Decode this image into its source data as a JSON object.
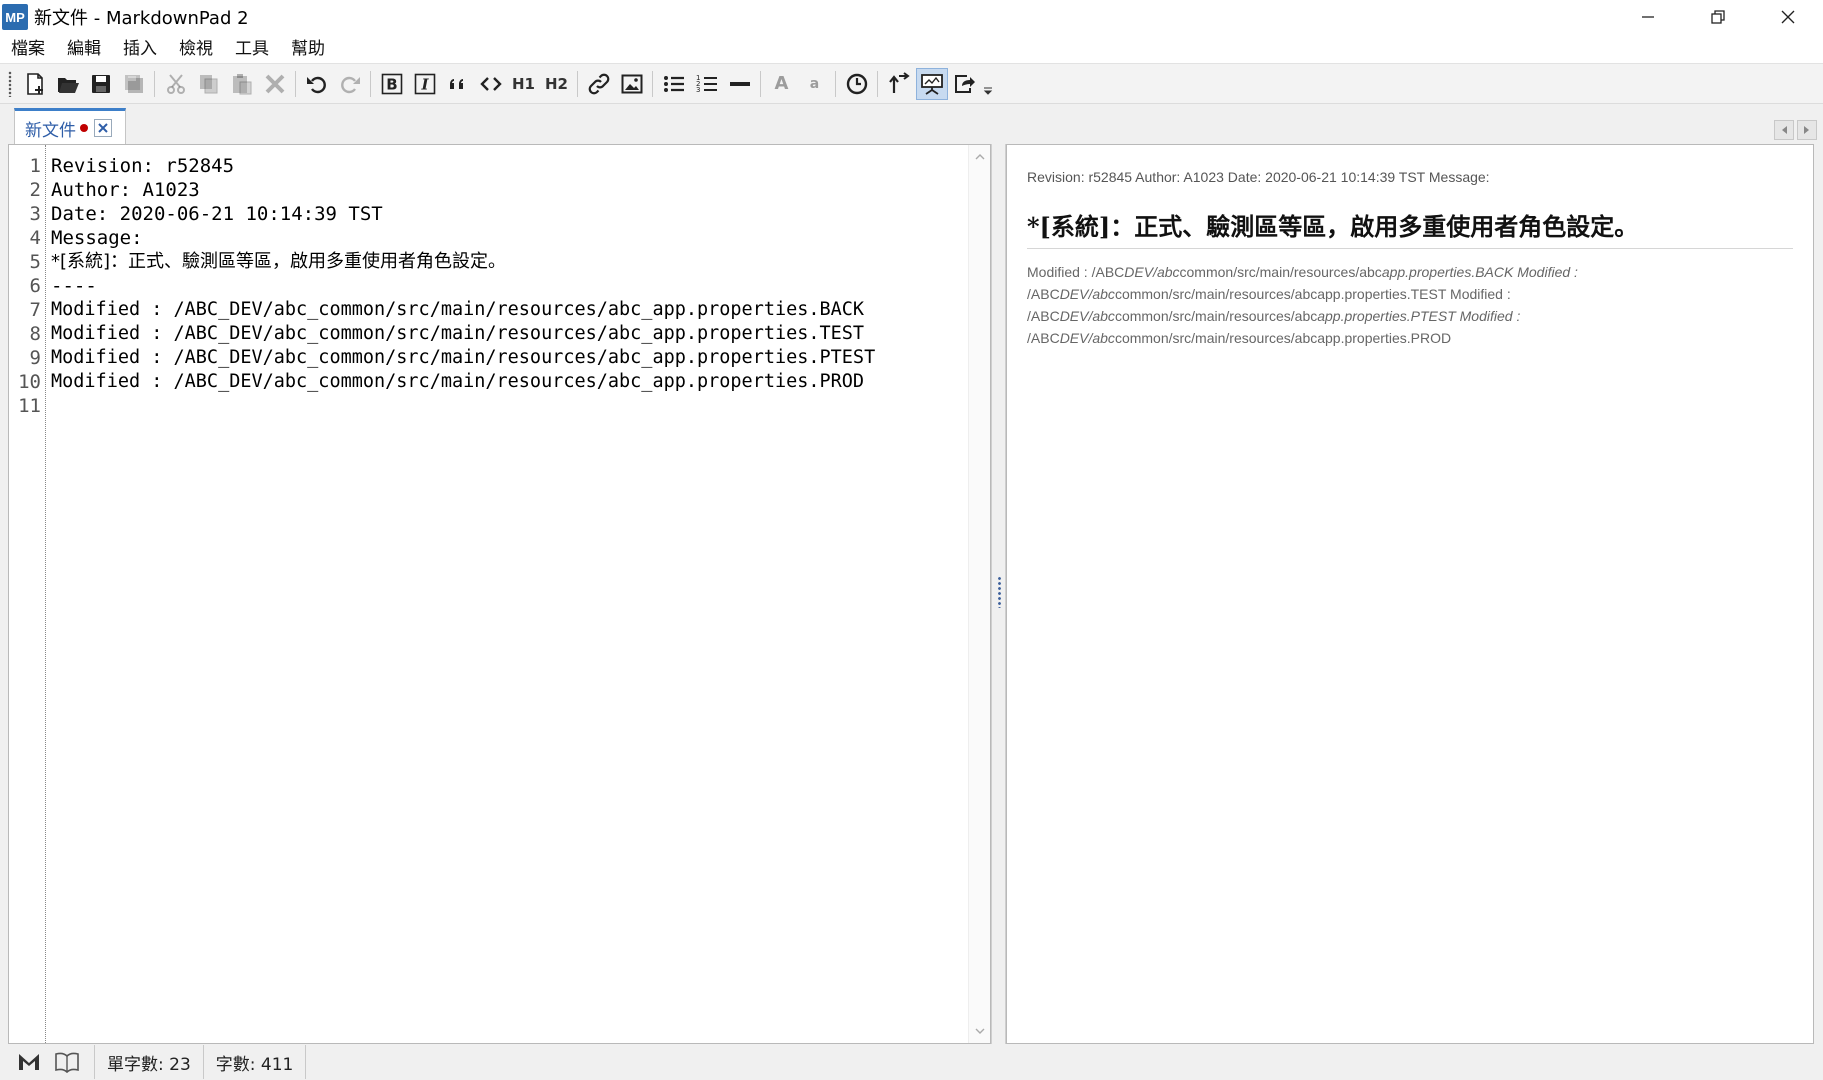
{
  "window": {
    "logo_text": "MP",
    "title": "新文件 - MarkdownPad 2"
  },
  "menu": {
    "items": [
      "檔案",
      "編輯",
      "插入",
      "檢視",
      "工具",
      "幫助"
    ]
  },
  "toolbar": {
    "h1_label": "H1",
    "h2_label": "H2",
    "font_big_label": "A",
    "font_small_label": "a"
  },
  "tab": {
    "label": "新文件"
  },
  "editor": {
    "line_numbers": [
      "1",
      "2",
      "3",
      "4",
      "5",
      "6",
      "7",
      "8",
      "9",
      "10",
      "11"
    ],
    "lines": [
      "Revision: r52845",
      "Author: A1023",
      "Date: 2020-06-21 10:14:39 TST",
      "Message:",
      "*[系統]：正式、驗測區等區，啟用多重使用者角色設定。",
      "----",
      "Modified : /ABC_DEV/abc_common/src/main/resources/abc_app.properties.BACK",
      "Modified : /ABC_DEV/abc_common/src/main/resources/abc_app.properties.TEST",
      "Modified : /ABC_DEV/abc_common/src/main/resources/abc_app.properties.PTEST",
      "Modified : /ABC_DEV/abc_common/src/main/resources/abc_app.properties.PROD",
      ""
    ]
  },
  "preview": {
    "paragraph": "Revision: r52845 Author: A1023 Date: 2020-06-21 10:14:39 TST Message:",
    "heading": "*[系統]：正式、驗測區等區，啟用多重使用者角色設定。",
    "mods": [
      {
        "a": "Modified : /ABC",
        "b": "DEV/abc",
        "c": "common/src/main/resources/abc",
        "d": "app.properties.BACK Modified :"
      },
      {
        "a": "/ABC",
        "b": "DEV/abc",
        "c": "common/src/main/resources/abc",
        "d": "app.properties.TEST Modified :"
      },
      {
        "a": "/ABC",
        "b": "DEV/abc",
        "c": "common/src/main/resources/abc",
        "d": "app.properties.PTEST Modified :"
      },
      {
        "a": "/ABC",
        "b": "DEV/abc",
        "c": "common/src/main/resources/abc",
        "d": "app.properties.PROD"
      }
    ]
  },
  "status": {
    "word_count": "單字數: 23",
    "char_count": "字數: 411"
  }
}
